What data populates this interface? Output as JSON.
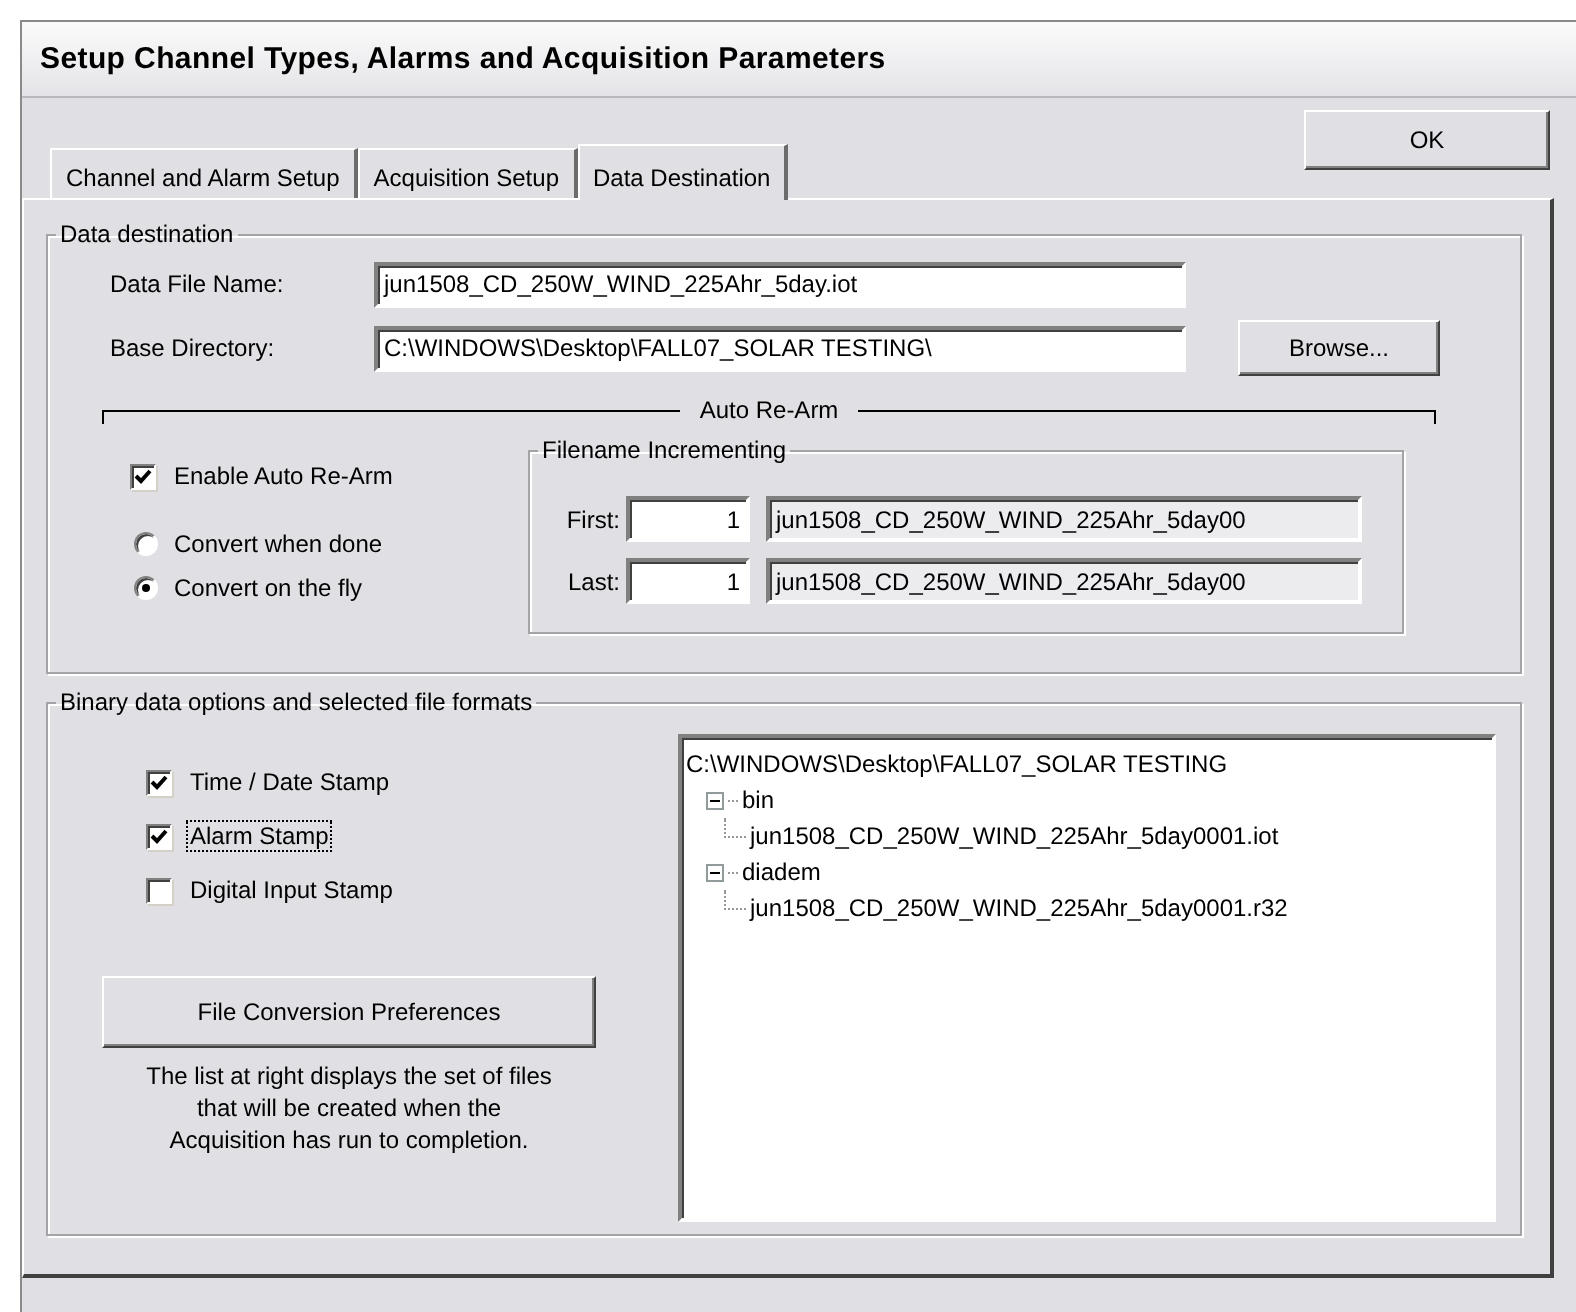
{
  "window": {
    "title": "Setup Channel Types, Alarms and Acquisition Parameters"
  },
  "ok_button": "OK",
  "tabs": [
    {
      "label": "Channel and Alarm Setup",
      "selected": false
    },
    {
      "label": "Acquisition Setup",
      "selected": false
    },
    {
      "label": "Data Destination",
      "selected": true
    }
  ],
  "data_destination": {
    "title": "Data destination",
    "fields": [
      {
        "label": "Data File Name:",
        "value": "jun1508_CD_250W_WIND_225Ahr_5day.iot"
      },
      {
        "label": "Base Directory:",
        "value": "C:\\WINDOWS\\Desktop\\FALL07_SOLAR TESTING\\"
      }
    ],
    "browse_button": "Browse...",
    "auto_rearm": {
      "title": "Auto Re-Arm",
      "enable": {
        "label": "Enable Auto Re-Arm",
        "checked": true
      },
      "convert_options": [
        {
          "label": "Convert when done",
          "selected": false
        },
        {
          "label": "Convert on the fly",
          "selected": true
        }
      ],
      "filename_incrementing": {
        "title": "Filename Incrementing",
        "rows": [
          {
            "label": "First:",
            "number": "1",
            "filename": "jun1508_CD_250W_WIND_225Ahr_5day00"
          },
          {
            "label": "Last:",
            "number": "1",
            "filename": "jun1508_CD_250W_WIND_225Ahr_5day00"
          }
        ]
      }
    }
  },
  "binary_options": {
    "title": "Binary data options and selected file formats",
    "stamps": [
      {
        "label": "Time / Date Stamp",
        "checked": true,
        "focused": false
      },
      {
        "label": "Alarm Stamp",
        "checked": true,
        "focused": true
      },
      {
        "label": "Digital Input Stamp",
        "checked": false,
        "focused": false
      }
    ],
    "preferences_button": "File Conversion Preferences",
    "note": "The list at right displays the set of files that will be created when the Acquisition has run to completion.",
    "file_tree": {
      "root": "C:\\WINDOWS\\Desktop\\FALL07_SOLAR TESTING",
      "children": [
        {
          "label": "bin",
          "expanded": true,
          "children": [
            {
              "label": "jun1508_CD_250W_WIND_225Ahr_5day0001.iot"
            }
          ]
        },
        {
          "label": "diadem",
          "expanded": true,
          "children": [
            {
              "label": "jun1508_CD_250W_WIND_225Ahr_5day0001.r32"
            }
          ]
        }
      ]
    }
  }
}
